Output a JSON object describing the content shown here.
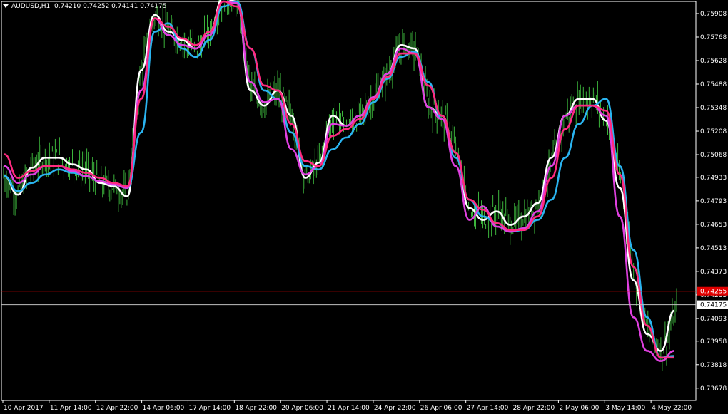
{
  "header": {
    "symbol": "AUDUSD,H1",
    "ohlc": "0.74210 0.74252 0.74141 0.74175"
  },
  "colors": {
    "background": "#000000",
    "grid_axis": "#ffffff",
    "candles": "#3cb43c",
    "bid_line": "#c0c0c0",
    "ask_line": "#e00000",
    "ask_label_bg": "#e00000"
  },
  "chart_data": {
    "type": "line",
    "price_axis_labels": [
      "0.75908",
      "0.75768",
      "0.75628",
      "0.75488",
      "0.75348",
      "0.75208",
      "0.75068",
      "0.74933",
      "0.74793",
      "0.74653",
      "0.74513",
      "0.74373",
      "0.74233",
      "0.74093",
      "0.73958",
      "0.73818",
      "0.73678"
    ],
    "time_axis_labels": [
      "10 Apr 2017",
      "11 Apr 14:00",
      "12 Apr 22:00",
      "14 Apr 06:00",
      "17 Apr 14:00",
      "18 Apr 22:00",
      "20 Apr 06:00",
      "21 Apr 14:00",
      "24 Apr 22:00",
      "26 Apr 06:00",
      "27 Apr 14:00",
      "28 Apr 22:00",
      "2 May 06:00",
      "3 May 14:00",
      "4 May 22:00"
    ],
    "current_bid": {
      "value": 0.74175,
      "label": "0.74175"
    },
    "ask_level": {
      "value": 0.74255,
      "label": "0.74255"
    },
    "ylim": [
      0.7364,
      0.7602
    ],
    "series": [
      {
        "color": "#ffffff",
        "values": [
          0.7494,
          0.7483,
          0.7499,
          0.7505,
          0.7505,
          0.7501,
          0.7498,
          0.749,
          0.7488,
          0.7482,
          0.7557,
          0.759,
          0.758,
          0.7575,
          0.757,
          0.758,
          0.76,
          0.7598,
          0.7545,
          0.7536,
          0.7545,
          0.753,
          0.7493,
          0.7502,
          0.753,
          0.7524,
          0.753,
          0.7541,
          0.7555,
          0.7572,
          0.757,
          0.7535,
          0.753,
          0.7508,
          0.7475,
          0.7468,
          0.7473,
          0.7465,
          0.747,
          0.7478,
          0.7505,
          0.753,
          0.754,
          0.754,
          0.7527,
          0.7487,
          0.7432,
          0.74,
          0.739,
          0.7414
        ]
      },
      {
        "color": "#2ab4f0",
        "values": [
          0.7494,
          0.7485,
          0.749,
          0.7495,
          0.7498,
          0.7496,
          0.7494,
          0.7491,
          0.7489,
          0.7487,
          0.752,
          0.758,
          0.7585,
          0.757,
          0.7565,
          0.7575,
          0.7595,
          0.7598,
          0.757,
          0.7545,
          0.754,
          0.752,
          0.75,
          0.7498,
          0.751,
          0.7517,
          0.7525,
          0.7538,
          0.7552,
          0.7565,
          0.7568,
          0.755,
          0.7528,
          0.7505,
          0.748,
          0.747,
          0.7466,
          0.7461,
          0.7462,
          0.7468,
          0.748,
          0.7505,
          0.7525,
          0.7536,
          0.754,
          0.75,
          0.745,
          0.741,
          0.7386,
          0.7387
        ]
      },
      {
        "color": "#e040e0",
        "values": [
          0.75,
          0.749,
          0.7495,
          0.75,
          0.75,
          0.7497,
          0.7494,
          0.7491,
          0.7489,
          0.7487,
          0.7545,
          0.7588,
          0.7578,
          0.7572,
          0.757,
          0.7578,
          0.7598,
          0.7597,
          0.755,
          0.7538,
          0.754,
          0.751,
          0.7495,
          0.75,
          0.7525,
          0.7524,
          0.753,
          0.7541,
          0.7555,
          0.757,
          0.7567,
          0.7535,
          0.7528,
          0.75,
          0.7468,
          0.7476,
          0.7464,
          0.7461,
          0.7463,
          0.7473,
          0.75,
          0.753,
          0.7536,
          0.7536,
          0.753,
          0.747,
          0.741,
          0.739,
          0.7384,
          0.739
        ]
      },
      {
        "color": "#ff2a80",
        "values": [
          0.7507,
          0.7493,
          0.7497,
          0.75,
          0.75,
          0.7498,
          0.7496,
          0.7493,
          0.749,
          0.7488,
          0.754,
          0.7588,
          0.7583,
          0.7576,
          0.7572,
          0.758,
          0.7598,
          0.7595,
          0.757,
          0.7548,
          0.7545,
          0.7525,
          0.7503,
          0.75,
          0.7518,
          0.7522,
          0.7528,
          0.754,
          0.7553,
          0.7567,
          0.7567,
          0.7548,
          0.753,
          0.7508,
          0.748,
          0.7474,
          0.7466,
          0.7462,
          0.7462,
          0.747,
          0.7493,
          0.7522,
          0.7536,
          0.7536,
          0.7533,
          0.7495,
          0.744,
          0.7405,
          0.7386,
          0.7386
        ]
      }
    ]
  }
}
